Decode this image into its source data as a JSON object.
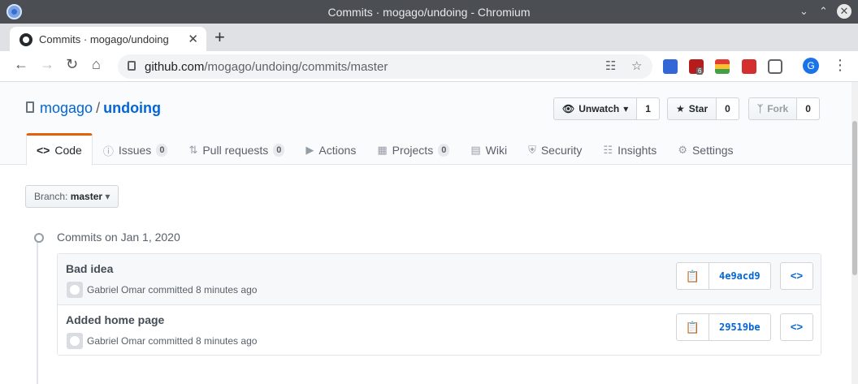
{
  "window": {
    "title": "Commits · mogago/undoing - Chromium"
  },
  "browser": {
    "tab_title": "Commits · mogago/undoing",
    "url_host": "github.com",
    "url_path": "/mogago/undoing/commits/master",
    "profile_initial": "G",
    "extension_badge": "6"
  },
  "repo": {
    "owner": "mogago",
    "separator": "/",
    "name": "undoing",
    "watch_label": "Unwatch",
    "watch_count": "1",
    "star_label": "Star",
    "star_count": "0",
    "fork_label": "Fork",
    "fork_count": "0"
  },
  "nav": {
    "code": "Code",
    "issues": "Issues",
    "issues_count": "0",
    "pulls": "Pull requests",
    "pulls_count": "0",
    "actions": "Actions",
    "projects": "Projects",
    "projects_count": "0",
    "wiki": "Wiki",
    "security": "Security",
    "insights": "Insights",
    "settings": "Settings"
  },
  "branch": {
    "prefix": "Branch:",
    "name": "master"
  },
  "commits_heading": "Commits on Jan 1, 2020",
  "commits": [
    {
      "message": "Bad idea",
      "meta": "Gabriel Omar committed 8 minutes ago",
      "sha": "4e9acd9"
    },
    {
      "message": "Added home page",
      "meta": "Gabriel Omar committed 8 minutes ago",
      "sha": "29519be"
    }
  ],
  "colors": {
    "link": "#0366d6",
    "tab_accent": "#e36209"
  }
}
